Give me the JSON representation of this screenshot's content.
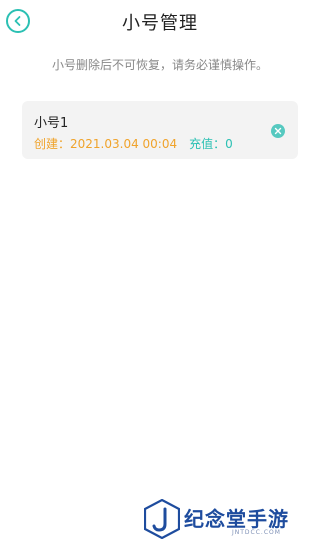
{
  "header": {
    "title": "小号管理",
    "back_icon": "chevron-left-icon"
  },
  "notice": "小号删除后不可恢复，请务必谨慎操作。",
  "accounts": [
    {
      "name": "小号1",
      "created_label": "创建：2021.03.04 00:04",
      "recharge_label": "充值：0",
      "delete_icon": "close-icon"
    }
  ],
  "watermark": {
    "text": "纪念堂手游",
    "domain": "JNTDCC.COM"
  },
  "colors": {
    "accent": "#2bc0b3",
    "created": "#f0a32b",
    "card_bg": "#f3f3f3",
    "watermark": "#1e4c9e"
  }
}
